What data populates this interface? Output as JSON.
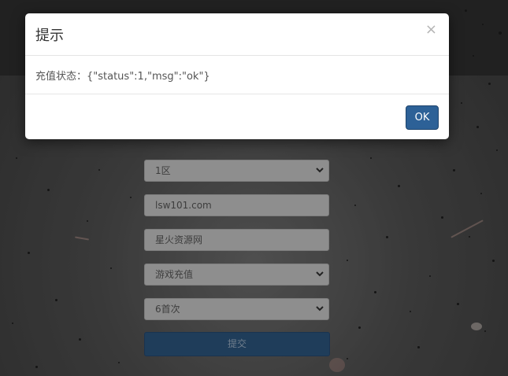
{
  "dialog": {
    "title": "提示",
    "close_glyph": "×",
    "message": "充值状态：{\"status\":1,\"msg\":\"ok\"}",
    "ok_label": "OK",
    "ok_color": "#2d6197"
  },
  "form": {
    "server_select": "1区",
    "account_input": "lsw101.com",
    "name_input": "星火资源网",
    "type_select": "游戏充值",
    "amount_select": "6首次",
    "submit_label": "提交",
    "chevron_glyph": "❯"
  },
  "icons": {
    "close": "close-icon",
    "select_chevron": "chevron-down-icon"
  }
}
